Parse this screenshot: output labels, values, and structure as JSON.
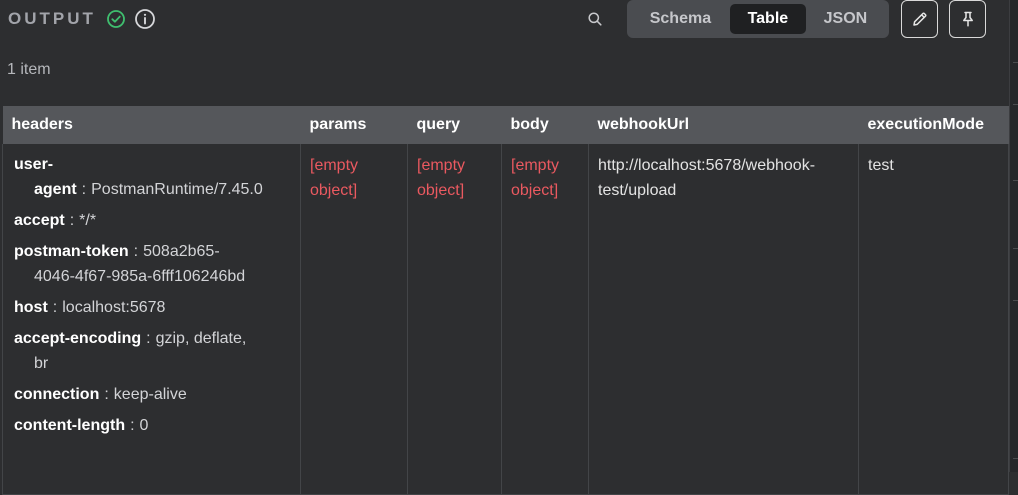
{
  "header": {
    "title": "OUTPUT",
    "colors": {
      "success": "#3fbf6f",
      "muted": "#a2a4aa"
    }
  },
  "view_toggle": {
    "options": [
      "Schema",
      "Table",
      "JSON"
    ],
    "selected": "Table"
  },
  "item_count": "1 item",
  "table": {
    "columns": [
      "headers",
      "params",
      "query",
      "body",
      "webhookUrl",
      "executionMode"
    ],
    "row": {
      "headers": [
        {
          "key": "user-",
          "key_cont": "agent",
          "sep": ":",
          "value": "PostmanRuntime/7.45.0"
        },
        {
          "key": "accept",
          "sep": ":",
          "value": "*/*"
        },
        {
          "key": "postman-token",
          "sep": ":",
          "value": "508a2b65-",
          "value_cont": "4046-4f67-985a-6fff106246bd"
        },
        {
          "key": "host",
          "sep": ":",
          "value": "localhost:5678"
        },
        {
          "key": "accept-encoding",
          "sep": ":",
          "value": "gzip, deflate,",
          "value_cont": "br"
        },
        {
          "key": "connection",
          "sep": ":",
          "value": "keep-alive"
        },
        {
          "key": "content-length",
          "sep": ":",
          "value": "0"
        }
      ],
      "params": "[empty object]",
      "query": "[empty object]",
      "body": "[empty object]",
      "webhookUrl": "http://localhost:5678/webhook-test/upload",
      "executionMode": "test"
    },
    "colors": {
      "empty": "#ea5960",
      "header_bg": "#55575b"
    }
  }
}
